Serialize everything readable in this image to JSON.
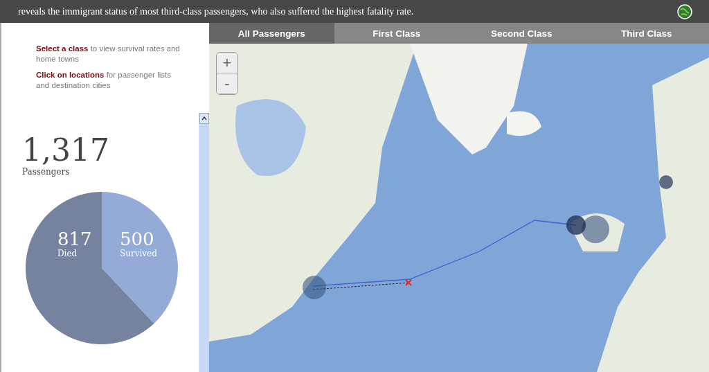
{
  "header": {
    "text": "reveals the immigrant status of most third-class passengers, who also suffered the highest fatality rate."
  },
  "tabs": [
    {
      "label": "All Passengers",
      "selected": true
    },
    {
      "label": "First Class",
      "selected": false
    },
    {
      "label": "Second Class",
      "selected": false
    },
    {
      "label": "Third Class",
      "selected": false
    }
  ],
  "instructions": [
    {
      "lead": "Select a class",
      "rest": "to view survival rates and home towns"
    },
    {
      "lead": "Click on locations",
      "rest": "for passenger lists and destination cities"
    }
  ],
  "total": {
    "value": "1,317",
    "label": "Passengers"
  },
  "pie": {
    "chart_data": {
      "type": "pie",
      "categories": [
        "Died",
        "Survived"
      ],
      "values": [
        817,
        500
      ],
      "data_labels": true
    },
    "slices": [
      {
        "color": "#75839f"
      },
      {
        "color": "#93abd6"
      }
    ]
  },
  "zoom": {
    "in": "+",
    "out": "-"
  }
}
